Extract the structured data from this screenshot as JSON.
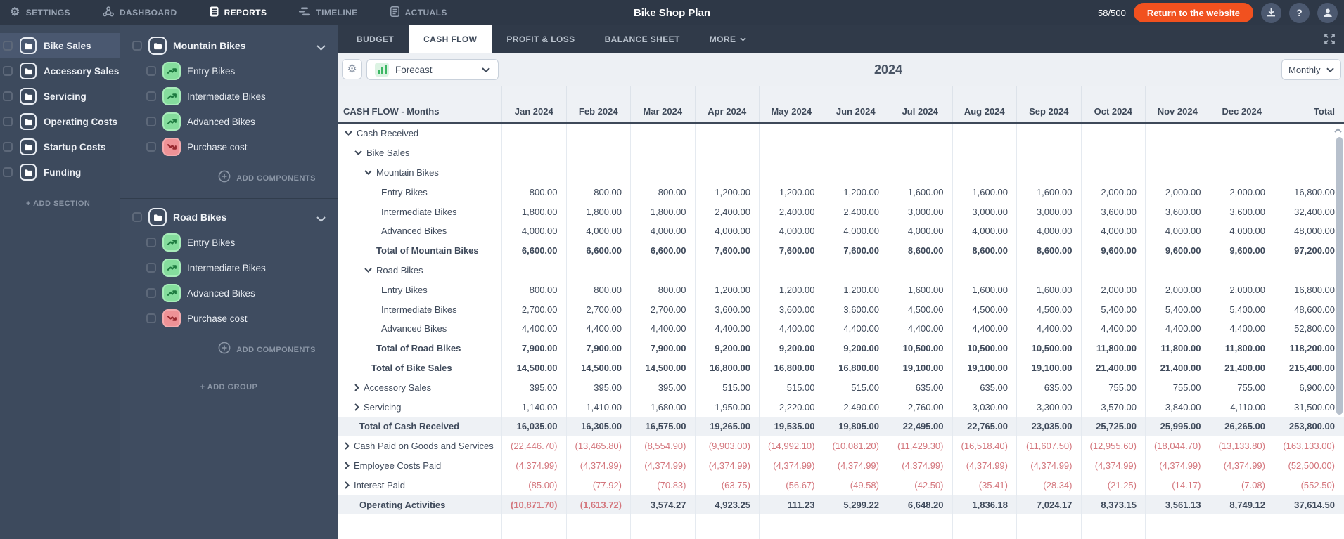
{
  "topbar": {
    "nav": [
      {
        "label": "SETTINGS"
      },
      {
        "label": "DASHBOARD"
      },
      {
        "label": "REPORTS",
        "active": true
      },
      {
        "label": "TIMELINE"
      },
      {
        "label": "ACTUALS"
      }
    ],
    "title": "Bike Shop Plan",
    "usage": "58/500",
    "return_button": "Return to the website"
  },
  "sidebar": {
    "sections": [
      {
        "label": "Bike Sales",
        "selected": true
      },
      {
        "label": "Accessory Sales"
      },
      {
        "label": "Servicing"
      },
      {
        "label": "Operating Costs"
      },
      {
        "label": "Startup Costs"
      },
      {
        "label": "Funding"
      }
    ],
    "add_section_label": "+ ADD SECTION"
  },
  "panel": {
    "groups": [
      {
        "label": "Mountain Bikes",
        "items": [
          {
            "label": "Entry Bikes",
            "type": "income"
          },
          {
            "label": "Intermediate Bikes",
            "type": "income"
          },
          {
            "label": "Advanced Bikes",
            "type": "income"
          },
          {
            "label": "Purchase cost",
            "type": "cost"
          }
        ],
        "add_components_label": "ADD COMPONENTS"
      },
      {
        "label": "Road Bikes",
        "items": [
          {
            "label": "Entry Bikes",
            "type": "income"
          },
          {
            "label": "Intermediate Bikes",
            "type": "income"
          },
          {
            "label": "Advanced Bikes",
            "type": "income"
          },
          {
            "label": "Purchase cost",
            "type": "cost"
          }
        ],
        "add_components_label": "ADD COMPONENTS"
      }
    ],
    "add_group_label": "+ ADD GROUP"
  },
  "report": {
    "tabs": [
      {
        "label": "BUDGET"
      },
      {
        "label": "CASH FLOW",
        "active": true
      },
      {
        "label": "PROFIT & LOSS"
      },
      {
        "label": "BALANCE SHEET"
      },
      {
        "label": "MORE",
        "has_dropdown": true
      }
    ],
    "toolbar": {
      "view_selector": "Forecast",
      "year": "2024",
      "period_selector": "Monthly"
    },
    "table": {
      "title": "CASH FLOW - Months",
      "months": [
        "Jan 2024",
        "Feb 2024",
        "Mar 2024",
        "Apr 2024",
        "May 2024",
        "Jun 2024",
        "Jul 2024",
        "Aug 2024",
        "Sep 2024",
        "Oct 2024",
        "Nov 2024",
        "Dec 2024"
      ],
      "total_label": "Total",
      "rows": [
        {
          "label": "Cash Received",
          "level": "group0",
          "chevron": "down",
          "values": [],
          "total": ""
        },
        {
          "label": "Bike Sales",
          "level": "group1",
          "chevron": "down",
          "values": [],
          "total": ""
        },
        {
          "label": "Mountain Bikes",
          "level": "group2",
          "chevron": "down",
          "values": [],
          "total": ""
        },
        {
          "label": "Entry Bikes",
          "level": "item",
          "values": [
            "800.00",
            "800.00",
            "800.00",
            "1,200.00",
            "1,200.00",
            "1,200.00",
            "1,600.00",
            "1,600.00",
            "1,600.00",
            "2,000.00",
            "2,000.00",
            "2,000.00"
          ],
          "total": "16,800.00"
        },
        {
          "label": "Intermediate Bikes",
          "level": "item",
          "values": [
            "1,800.00",
            "1,800.00",
            "1,800.00",
            "2,400.00",
            "2,400.00",
            "2,400.00",
            "3,000.00",
            "3,000.00",
            "3,000.00",
            "3,600.00",
            "3,600.00",
            "3,600.00"
          ],
          "total": "32,400.00"
        },
        {
          "label": "Advanced Bikes",
          "level": "item",
          "values": [
            "4,000.00",
            "4,000.00",
            "4,000.00",
            "4,000.00",
            "4,000.00",
            "4,000.00",
            "4,000.00",
            "4,000.00",
            "4,000.00",
            "4,000.00",
            "4,000.00",
            "4,000.00"
          ],
          "total": "48,000.00"
        },
        {
          "label": "Total of Mountain Bikes",
          "level": "subtotal2",
          "bold": true,
          "values": [
            "6,600.00",
            "6,600.00",
            "6,600.00",
            "7,600.00",
            "7,600.00",
            "7,600.00",
            "8,600.00",
            "8,600.00",
            "8,600.00",
            "9,600.00",
            "9,600.00",
            "9,600.00"
          ],
          "total": "97,200.00"
        },
        {
          "label": "Road Bikes",
          "level": "group2",
          "chevron": "down",
          "values": [],
          "total": ""
        },
        {
          "label": "Entry Bikes",
          "level": "item",
          "values": [
            "800.00",
            "800.00",
            "800.00",
            "1,200.00",
            "1,200.00",
            "1,200.00",
            "1,600.00",
            "1,600.00",
            "1,600.00",
            "2,000.00",
            "2,000.00",
            "2,000.00"
          ],
          "total": "16,800.00"
        },
        {
          "label": "Intermediate Bikes",
          "level": "item",
          "values": [
            "2,700.00",
            "2,700.00",
            "2,700.00",
            "3,600.00",
            "3,600.00",
            "3,600.00",
            "4,500.00",
            "4,500.00",
            "4,500.00",
            "5,400.00",
            "5,400.00",
            "5,400.00"
          ],
          "total": "48,600.00"
        },
        {
          "label": "Advanced Bikes",
          "level": "item",
          "values": [
            "4,400.00",
            "4,400.00",
            "4,400.00",
            "4,400.00",
            "4,400.00",
            "4,400.00",
            "4,400.00",
            "4,400.00",
            "4,400.00",
            "4,400.00",
            "4,400.00",
            "4,400.00"
          ],
          "total": "52,800.00"
        },
        {
          "label": "Total of Road Bikes",
          "level": "subtotal2",
          "bold": true,
          "values": [
            "7,900.00",
            "7,900.00",
            "7,900.00",
            "9,200.00",
            "9,200.00",
            "9,200.00",
            "10,500.00",
            "10,500.00",
            "10,500.00",
            "11,800.00",
            "11,800.00",
            "11,800.00"
          ],
          "total": "118,200.00"
        },
        {
          "label": "Total of Bike Sales",
          "level": "subtotal1",
          "bold": true,
          "values": [
            "14,500.00",
            "14,500.00",
            "14,500.00",
            "16,800.00",
            "16,800.00",
            "16,800.00",
            "19,100.00",
            "19,100.00",
            "19,100.00",
            "21,400.00",
            "21,400.00",
            "21,400.00"
          ],
          "total": "215,400.00"
        },
        {
          "label": "Accessory Sales",
          "level": "group1",
          "chevron": "right",
          "values": [
            "395.00",
            "395.00",
            "395.00",
            "515.00",
            "515.00",
            "515.00",
            "635.00",
            "635.00",
            "635.00",
            "755.00",
            "755.00",
            "755.00"
          ],
          "total": "6,900.00"
        },
        {
          "label": "Servicing",
          "level": "group1",
          "chevron": "right",
          "values": [
            "1,140.00",
            "1,410.00",
            "1,680.00",
            "1,950.00",
            "2,220.00",
            "2,490.00",
            "2,760.00",
            "3,030.00",
            "3,300.00",
            "3,570.00",
            "3,840.00",
            "4,110.00"
          ],
          "total": "31,500.00"
        },
        {
          "label": "Total of Cash Received",
          "level": "subtotal0",
          "bold": true,
          "shaded": true,
          "values": [
            "16,035.00",
            "16,305.00",
            "16,575.00",
            "19,265.00",
            "19,535.00",
            "19,805.00",
            "22,495.00",
            "22,765.00",
            "23,035.00",
            "25,725.00",
            "25,995.00",
            "26,265.00"
          ],
          "total": "253,800.00"
        },
        {
          "label": "Cash Paid on Goods and Services",
          "level": "group0",
          "chevron": "right",
          "values": [
            "(22,446.70)",
            "(13,465.80)",
            "(8,554.90)",
            "(9,903.00)",
            "(14,992.10)",
            "(10,081.20)",
            "(11,429.30)",
            "(16,518.40)",
            "(11,607.50)",
            "(12,955.60)",
            "(18,044.70)",
            "(13,133.80)"
          ],
          "total": "(163,133.00)"
        },
        {
          "label": "Employee Costs Paid",
          "level": "group0",
          "chevron": "right",
          "values": [
            "(4,374.99)",
            "(4,374.99)",
            "(4,374.99)",
            "(4,374.99)",
            "(4,374.99)",
            "(4,374.99)",
            "(4,374.99)",
            "(4,374.99)",
            "(4,374.99)",
            "(4,374.99)",
            "(4,374.99)",
            "(4,374.99)"
          ],
          "total": "(52,500.00)"
        },
        {
          "label": "Interest Paid",
          "level": "group0",
          "chevron": "right",
          "values": [
            "(85.00)",
            "(77.92)",
            "(70.83)",
            "(63.75)",
            "(56.67)",
            "(49.58)",
            "(42.50)",
            "(35.41)",
            "(28.34)",
            "(21.25)",
            "(14.17)",
            "(7.08)"
          ],
          "total": "(552.50)"
        },
        {
          "label": "Operating Activities",
          "level": "subtotal0",
          "bold": true,
          "shaded": true,
          "values": [
            "(10,871.70)",
            "(1,613.72)",
            "3,574.27",
            "4,923.25",
            "111.23",
            "5,299.22",
            "6,648.20",
            "1,836.18",
            "7,024.17",
            "8,373.15",
            "3,561.13",
            "8,749.12"
          ],
          "total": "37,614.50"
        }
      ]
    }
  },
  "colors": {
    "accent_orange": "#f1511f",
    "negative_value": "#d4767d",
    "income_icon_green": "#85dd9d",
    "cost_icon_red": "#ee9296",
    "topbar_background": "#2e3847",
    "sidebar_background": "#3d4a5d"
  }
}
